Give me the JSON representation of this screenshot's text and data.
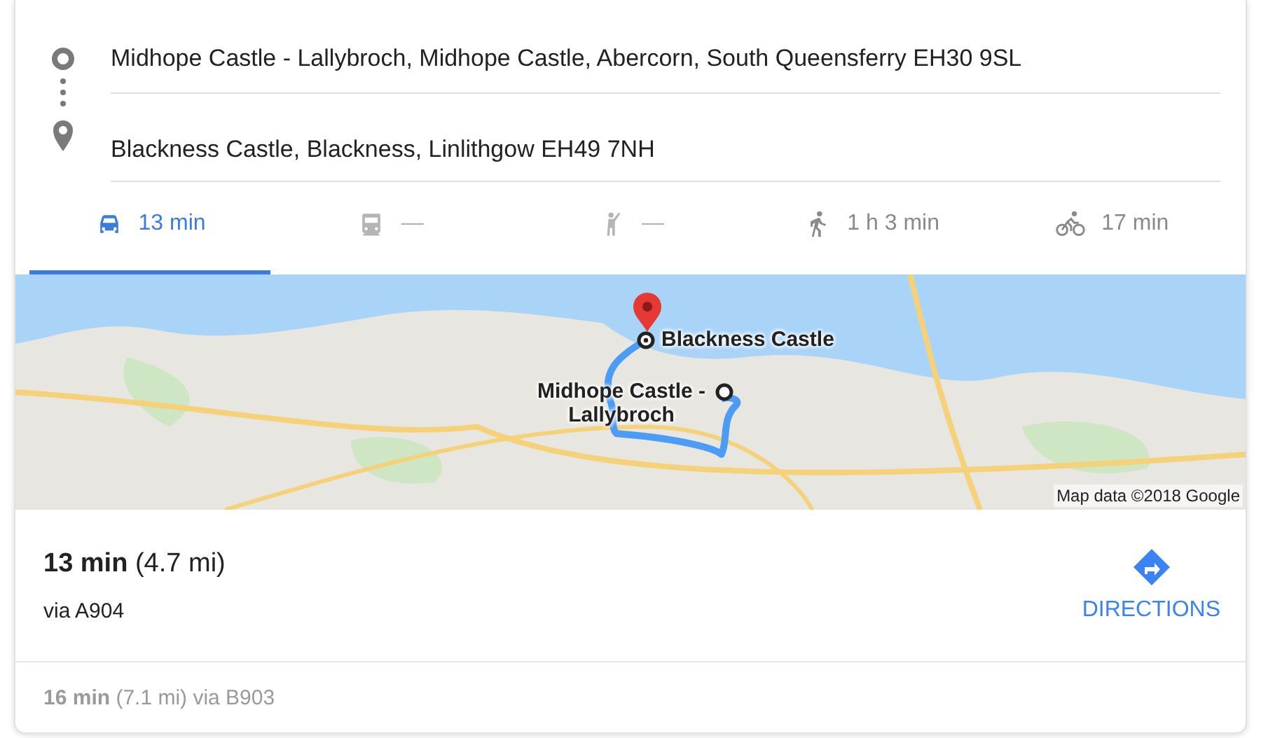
{
  "route": {
    "origin": "Midhope Castle - Lallybroch, Midhope Castle, Abercorn, South Queensferry EH30 9SL",
    "destination": "Blackness Castle, Blackness, Linlithgow EH49 7NH"
  },
  "tabs": [
    {
      "kind": "car",
      "label": "13 min",
      "selected": true,
      "disabled": false
    },
    {
      "kind": "transit",
      "label": "—",
      "selected": false,
      "disabled": true
    },
    {
      "kind": "ride",
      "label": "—",
      "selected": false,
      "disabled": true
    },
    {
      "kind": "walk",
      "label": "1 h 3 min",
      "selected": false,
      "disabled": false
    },
    {
      "kind": "bike",
      "label": "17 min",
      "selected": false,
      "disabled": false
    }
  ],
  "map": {
    "kind": "picture",
    "destination_label": "Blackness Castle",
    "origin_label": "Midhope Castle - Lallybroch",
    "attribution": "Map data ©2018 Google"
  },
  "summary": {
    "text": "**13 min** (4.7 mi)",
    "via": "via A904",
    "directions": "DIRECTIONS"
  },
  "alternate": {
    "text": "**16 min** (7.1 mi) via B903"
  }
}
